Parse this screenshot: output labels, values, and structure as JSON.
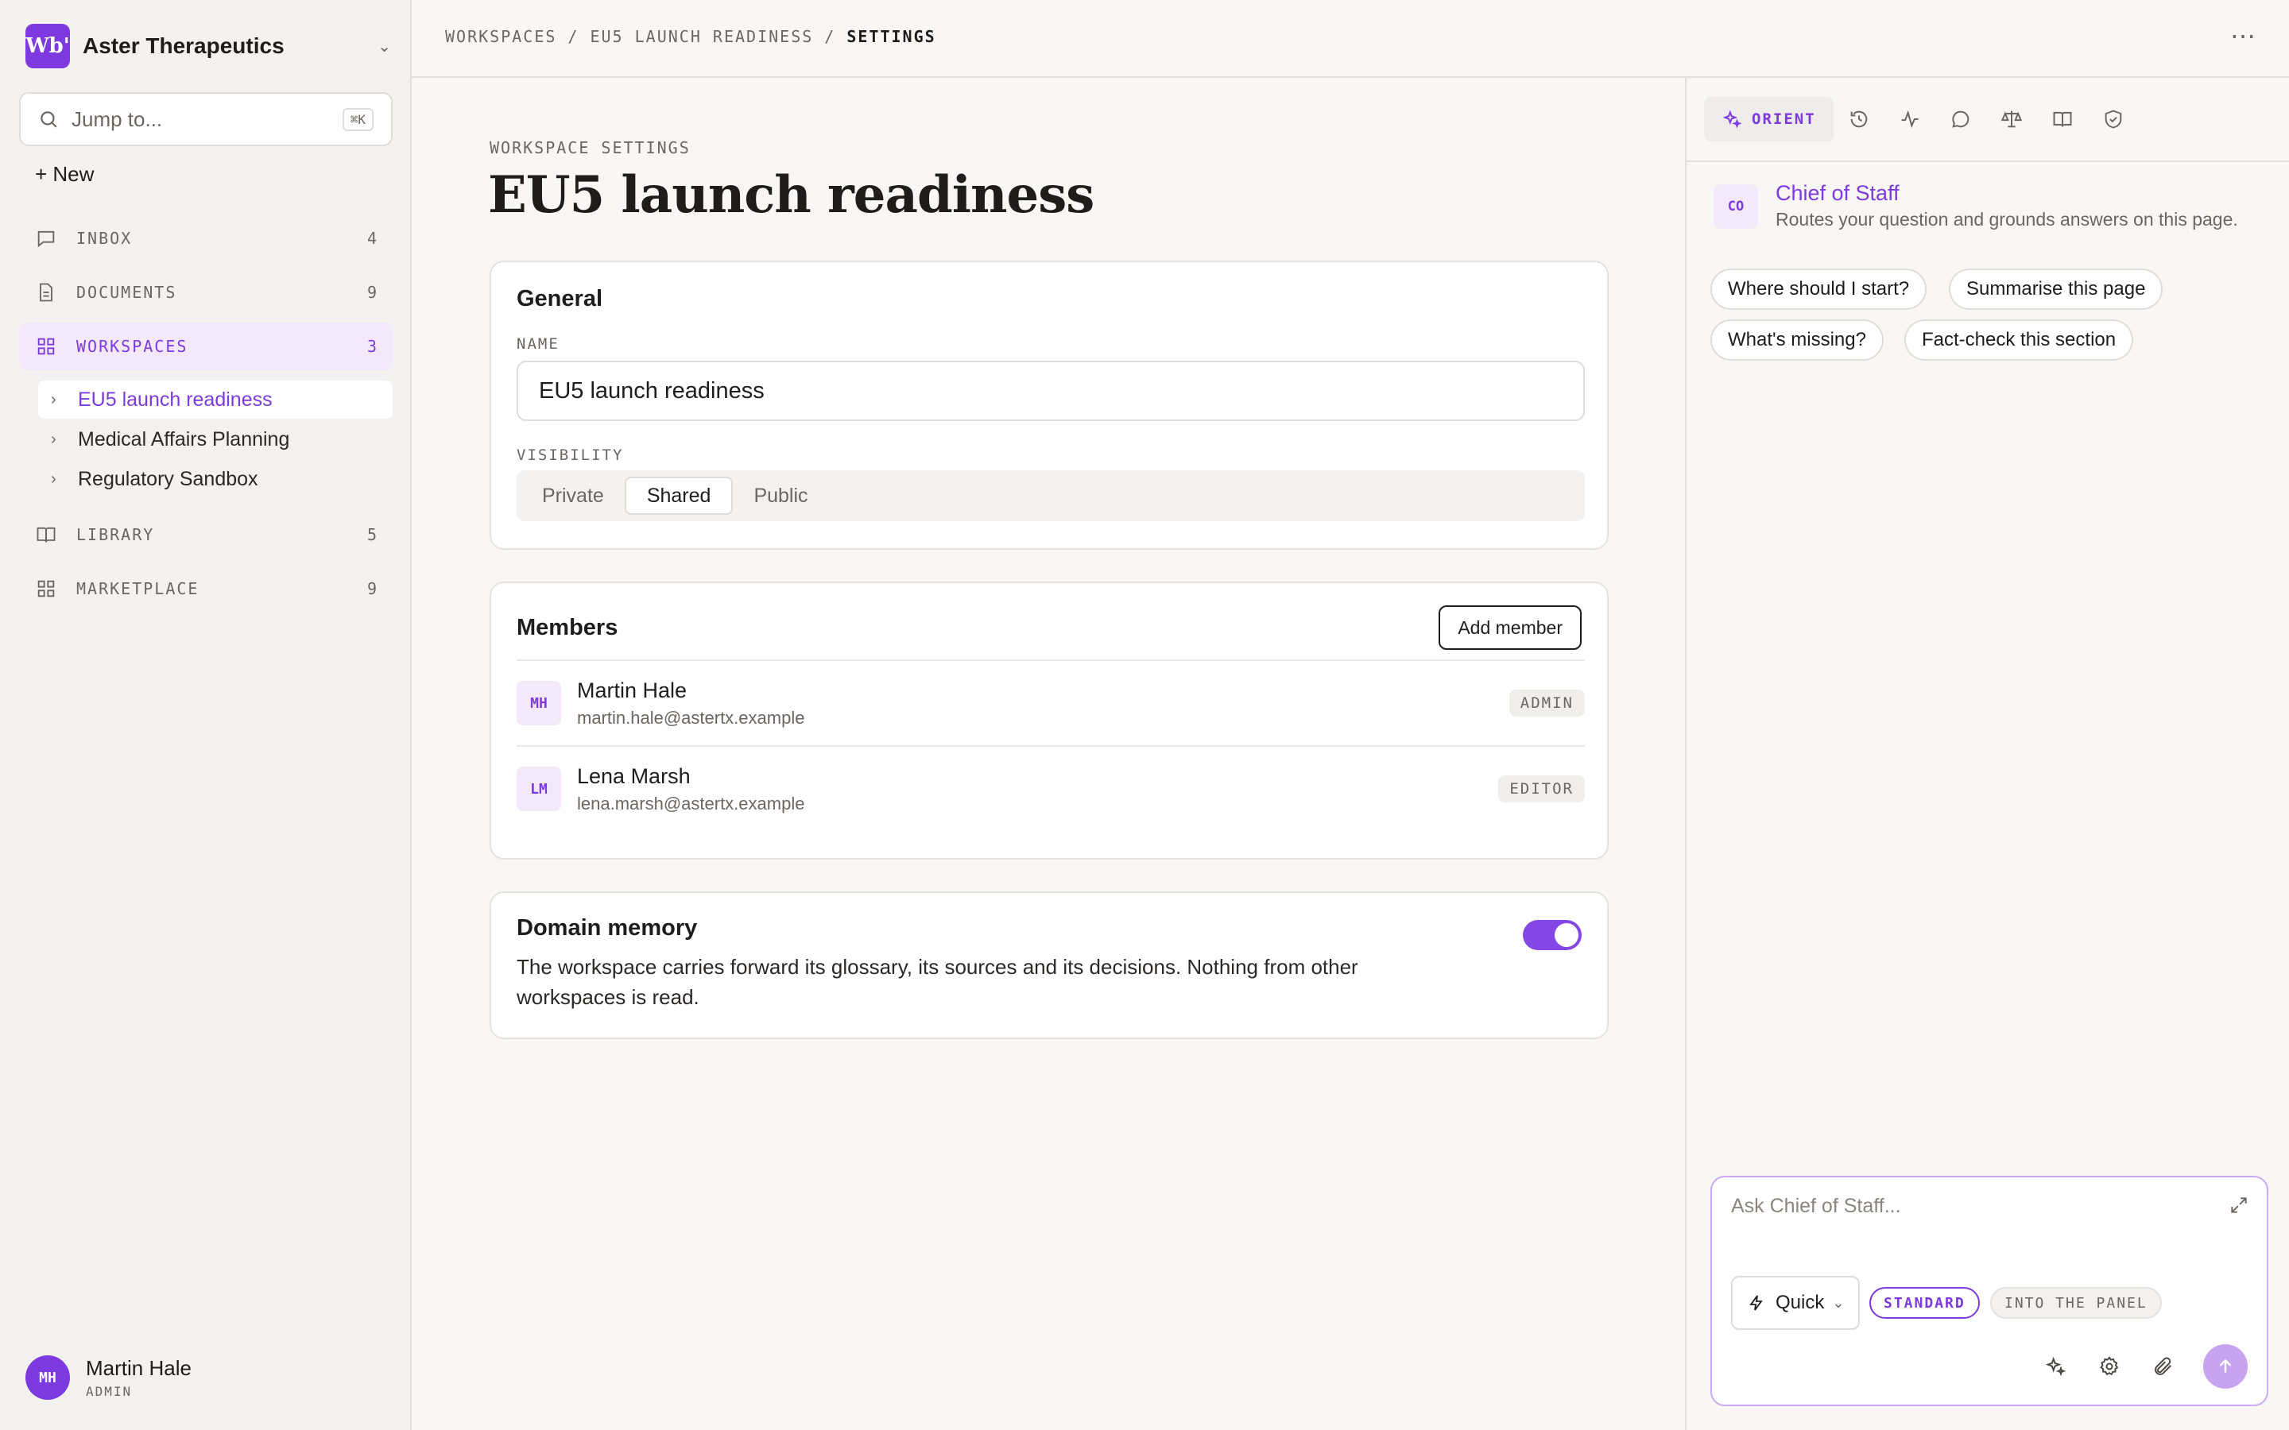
{
  "org": {
    "logo_text": "Wb'",
    "name": "Aster Therapeutics"
  },
  "search": {
    "placeholder": "Jump to...",
    "shortcut": "⌘K"
  },
  "sidebar": {
    "new_label": "+ New",
    "nav": [
      {
        "label": "INBOX",
        "count": "4",
        "icon": "chat-bubble-icon"
      },
      {
        "label": "DOCUMENTS",
        "count": "9",
        "icon": "document-icon"
      },
      {
        "label": "WORKSPACES",
        "count": "3",
        "icon": "grid-icon"
      },
      {
        "label": "LIBRARY",
        "count": "5",
        "icon": "book-icon"
      },
      {
        "label": "MARKETPLACE",
        "count": "9",
        "icon": "grid-icon"
      }
    ],
    "workspaces": [
      {
        "label": "EU5 launch readiness"
      },
      {
        "label": "Medical Affairs Planning"
      },
      {
        "label": "Regulatory Sandbox"
      }
    ]
  },
  "user": {
    "initials": "MH",
    "name": "Martin Hale",
    "role": "ADMIN"
  },
  "breadcrumb": {
    "items": [
      "WORKSPACES",
      "EU5 LAUNCH READINESS",
      "SETTINGS"
    ],
    "separator": "/"
  },
  "main": {
    "overline": "WORKSPACE SETTINGS",
    "title": "EU5 launch readiness",
    "general": {
      "title": "General",
      "name_label": "NAME",
      "name_value": "EU5 launch readiness",
      "visibility_label": "VISIBILITY",
      "visibility_options": [
        "Private",
        "Shared",
        "Public"
      ],
      "visibility_selected": "Shared"
    },
    "members": {
      "title": "Members",
      "add_label": "Add member",
      "list": [
        {
          "initials": "MH",
          "name": "Martin Hale",
          "email": "martin.hale@astertx.example",
          "role": "ADMIN"
        },
        {
          "initials": "LM",
          "name": "Lena Marsh",
          "email": "lena.marsh@astertx.example",
          "role": "EDITOR"
        }
      ]
    },
    "domain_memory": {
      "title": "Domain memory",
      "enabled": true,
      "description": "The workspace carries forward its glossary, its sources and its decisions. Nothing from other workspaces is read."
    }
  },
  "panel": {
    "active_tab": "ORIENT",
    "tab_icons": [
      "history-icon",
      "activity-icon",
      "chat-icon",
      "scale-icon",
      "book-icon",
      "shield-check-icon"
    ],
    "agent": {
      "badge": "CO",
      "name": "Chief of Staff",
      "description": "Routes your question and grounds answers on this page."
    },
    "suggestions": [
      "Where should I start?",
      "Summarise this page",
      "What's missing?",
      "Fact-check this section"
    ],
    "composer": {
      "placeholder": "Ask Chief of Staff...",
      "mode": "Quick",
      "pills": [
        "STANDARD",
        "INTO THE PANEL"
      ]
    }
  },
  "colors": {
    "accent": "#7c3ae0",
    "accent_light": "#f3e9fb",
    "toggle_on": "#8447e6"
  }
}
